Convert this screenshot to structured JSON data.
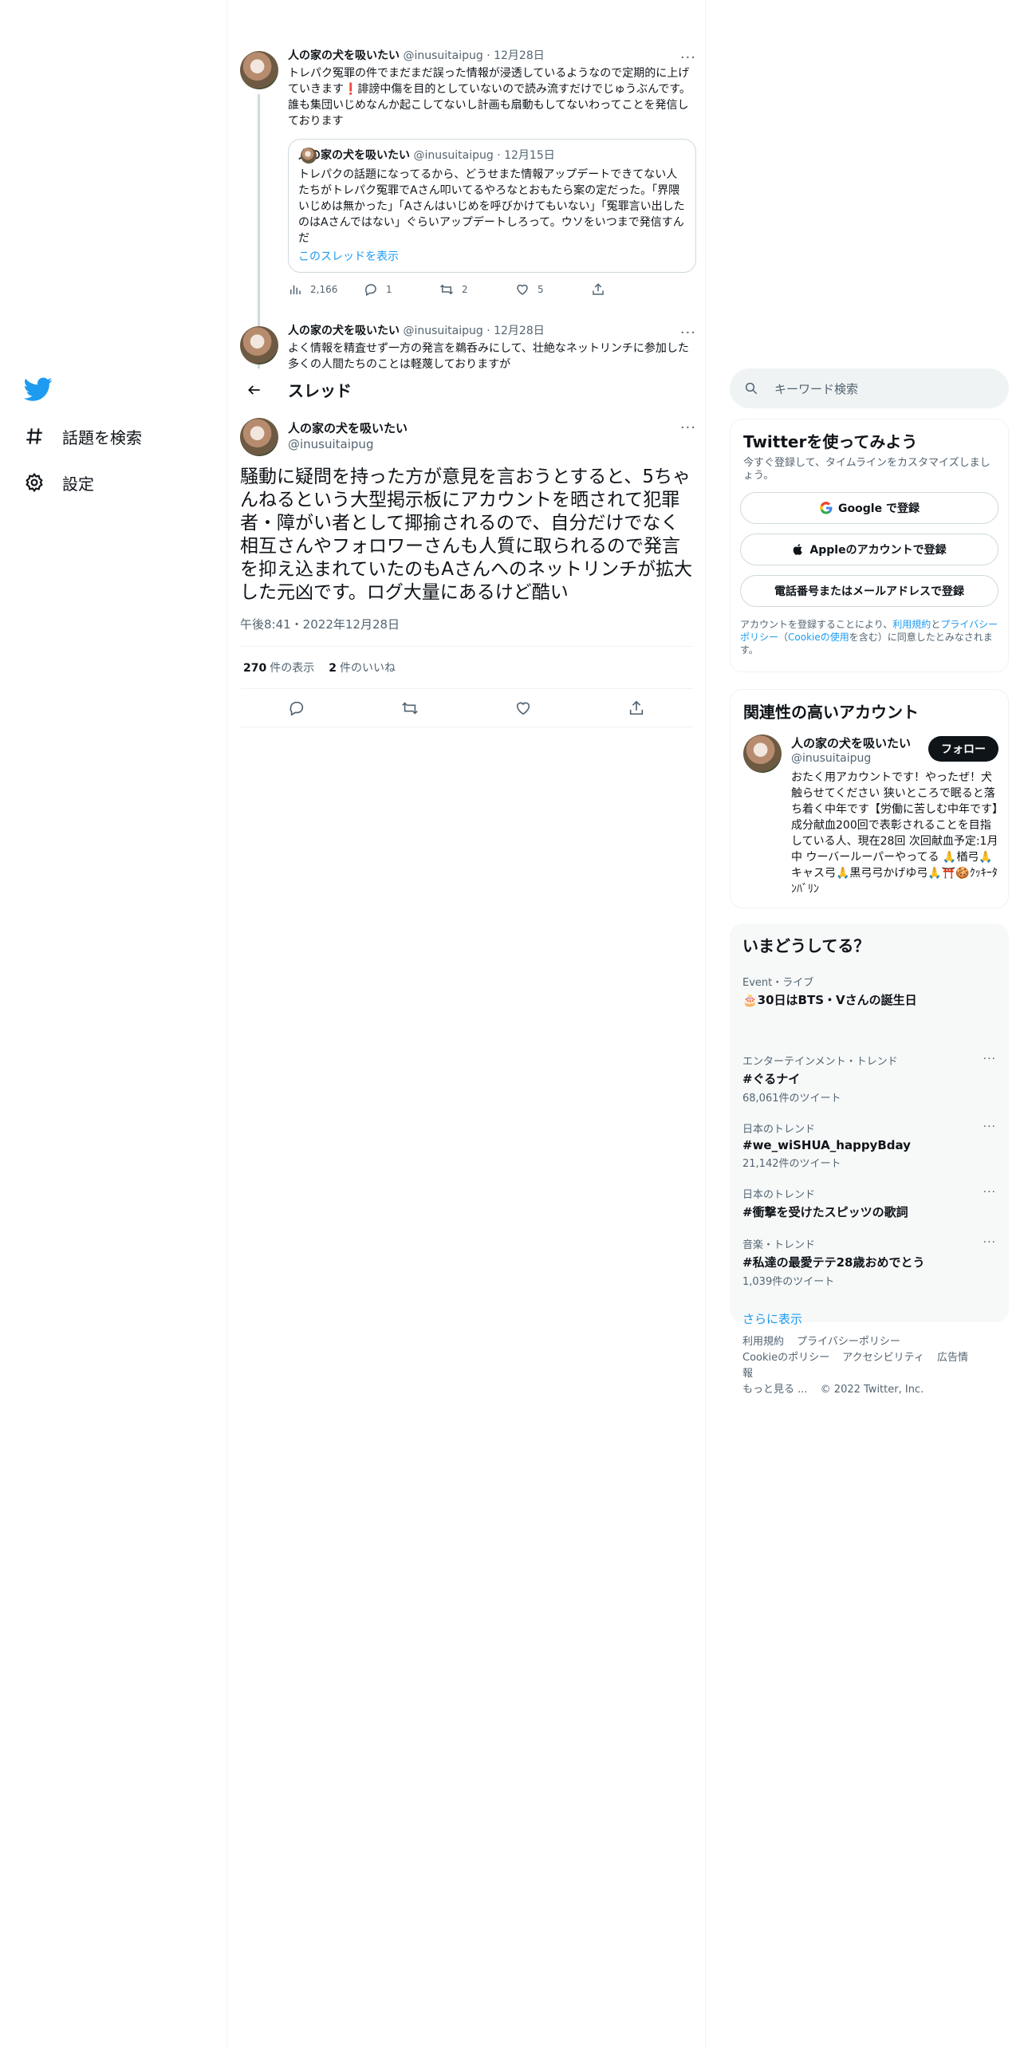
{
  "nav": {
    "explore_label": "話題を検索",
    "settings_label": "設定"
  },
  "context_tweets": [
    {
      "name": "人の家の犬を吸いたい",
      "handle": "@inusuitaipug",
      "date": "12月28日",
      "text": "トレパク冤罪の件でまだまだ誤った情報が浸透しているようなので定期的に上げていきます❗️誹謗中傷を目的としていないので読み流すだけでじゅうぶんです。誰も集団いじめなんか起こしてないし計画も扇動もしてないわってことを発信しております",
      "quote": {
        "name": "人の家の犬を吸いたい",
        "handle": "@inusuitaipug",
        "date": "12月15日",
        "text": "トレパクの話題になってるから、どうせまた情報アップデートできてない人たちがトレパク冤罪でAさん叩いてるやろなとおもたら案の定だった。「界隈いじめは無かった」「Aさんはいじめを呼びかけてもいない」「冤罪言い出したのはAさんではない」ぐらいアップデートしろって。ウソをいつまで発信すんだ",
        "link": "このスレッドを表示"
      },
      "views": "2,166",
      "replies": "1",
      "retweets": "2",
      "likes": "5"
    },
    {
      "name": "人の家の犬を吸いたい",
      "handle": "@inusuitaipug",
      "date": "12月28日",
      "text": "よく情報を精査せず一方の発言を鵜呑みにして、壮絶なネットリンチに参加した多くの人間たちのことは軽蔑しておりますが"
    }
  ],
  "thread_header": {
    "title": "スレッド"
  },
  "focus_tweet": {
    "name": "人の家の犬を吸いたい",
    "handle": "@inusuitaipug",
    "text": "騒動に疑問を持った方が意見を言おうとすると、5ちゃんねるという大型掲示板にアカウントを晒されて犯罪者・障がい者として揶揄されるので、自分だけでなく相互さんやフォロワーさんも人質に取られるので発言を抑え込まれていたのもAさんへのネットリンチが拡大した元凶です。ログ大量にあるけど酷い",
    "timestamp": "午後8:41・2022年12月28日",
    "views_count": "270",
    "views_label": "件の表示",
    "likes_count": "2",
    "likes_label": "件のいいね"
  },
  "search": {
    "placeholder": "キーワード検索"
  },
  "signup": {
    "title": "Twitterを使ってみよう",
    "subtitle": "今すぐ登録して、タイムラインをカスタマイズしましょう。",
    "google_label": "Google で登録",
    "apple_label": "Appleのアカウントで登録",
    "phone_label": "電話番号またはメールアドレスで登録",
    "legal_prefix": "アカウントを登録することにより、",
    "legal_terms": "利用規約",
    "legal_and": "と",
    "legal_privacy": "プライバシーポリシー",
    "legal_mid": "（",
    "legal_cookie": "Cookieの使用",
    "legal_suffix": "を含む）に同意したとみなされます。"
  },
  "related": {
    "title": "関連性の高いアカウント",
    "name": "人の家の犬を吸いたい",
    "handle": "@inusuitaipug",
    "follow_label": "フォロー",
    "bio": "おたく用アカウントです！やったぜ！犬触らせてください 狭いところで眠ると落ち着く中年です【労働に苦しむ中年です】成分献血200回で表彰されることを目指している人、現在28回 次回献血予定:1月中 ウーバールーパーやってる 🙏楢弓🙏キャス弓🙏黒弓弓かげゆ弓🙏⛩️🍪ｸｯｷｰﾀﾝﾊﾞﾘﾝ"
  },
  "trends": {
    "title": "いまどうしてる？",
    "items": [
      {
        "category": "Event・ライブ",
        "title": "🎂30日はBTS・Vさんの誕生日",
        "count": ""
      },
      {
        "category": "エンターテインメント・トレンド",
        "title": "#ぐるナイ",
        "count": "68,061件のツイート"
      },
      {
        "category": "日本のトレンド",
        "title": "#we_wiSHUA_happyBday",
        "count": "21,142件のツイート"
      },
      {
        "category": "日本のトレンド",
        "title": "#衝撃を受けたスピッツの歌詞",
        "count": ""
      },
      {
        "category": "音楽・トレンド",
        "title": "#私達の最愛テテ28歳おめでとう",
        "count": "1,039件のツイート"
      }
    ],
    "show_more": "さらに表示"
  },
  "footer": {
    "links": [
      "利用規約",
      "プライバシーポリシー",
      "Cookieのポリシー",
      "アクセシビリティ",
      "広告情報",
      "もっと見る ..."
    ],
    "copyright": "© 2022 Twitter, Inc."
  },
  "colors": {
    "accent": "#1d9bf0",
    "text": "#0f1419",
    "muted": "#536471",
    "border": "#eff3f4"
  }
}
